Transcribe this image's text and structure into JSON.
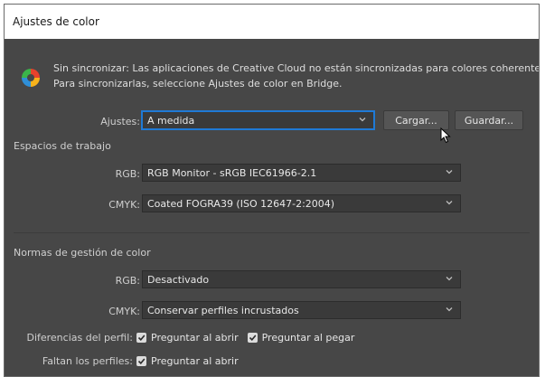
{
  "window": {
    "title": "Ajustes de color"
  },
  "notice": {
    "line1": "Sin sincronizar: Las aplicaciones de Creative Cloud no están sincronizadas para colores coherentes.",
    "line2": "Para sincronizarlas, seleccione Ajustes de color en Bridge."
  },
  "settings": {
    "label": "Ajustes:",
    "value": "A medida",
    "load_button": "Cargar...",
    "save_button": "Guardar..."
  },
  "working_spaces": {
    "title": "Espacios de trabajo",
    "rgb_label": "RGB:",
    "rgb_value": "RGB Monitor - sRGB IEC61966-2.1",
    "cmyk_label": "CMYK:",
    "cmyk_value": "Coated FOGRA39 (ISO 12647-2:2004)"
  },
  "policies": {
    "title": "Normas de gestión de color",
    "rgb_label": "RGB:",
    "rgb_value": "Desactivado",
    "cmyk_label": "CMYK:",
    "cmyk_value": "Conservar perfiles incrustados",
    "mismatch_label": "Diferencias del perfil:",
    "mismatch_open": "Preguntar al abrir",
    "mismatch_paste": "Preguntar al pegar",
    "missing_label": "Faltan los perfiles:",
    "missing_open": "Preguntar al abrir"
  },
  "colors": {
    "dialog_bg": "#474747",
    "field_bg": "#3a3a3a",
    "focus": "#1f7ad6"
  }
}
